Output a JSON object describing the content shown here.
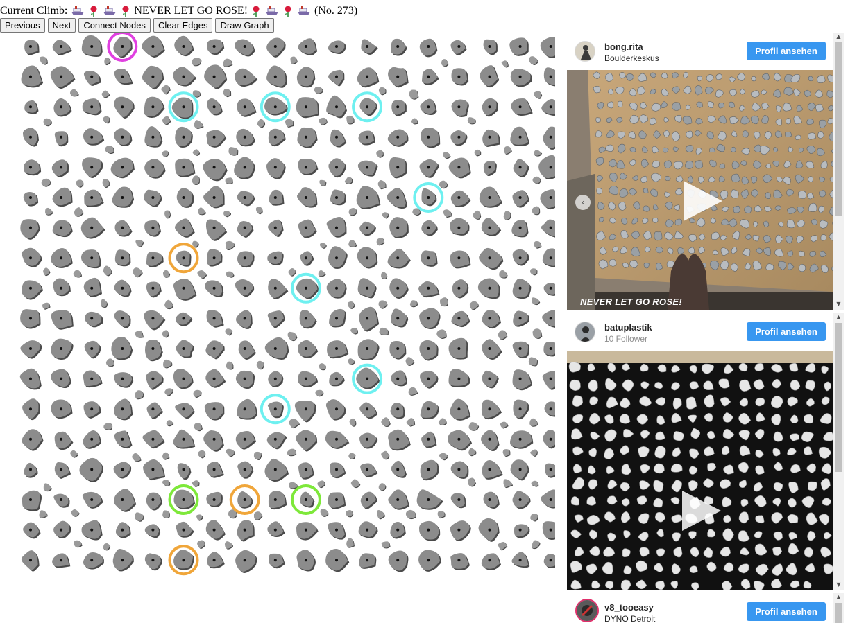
{
  "climb": {
    "label": "Current Climb:",
    "name": "NEVER LET GO ROSE!",
    "number": "(No. 273)"
  },
  "toolbar": {
    "previous_label": "Previous",
    "next_label": "Next",
    "connect_label": "Connect Nodes",
    "clear_label": "Clear Edges",
    "draw_label": "Draw Graph"
  },
  "colors": {
    "start": "#e040e0",
    "hand": "#6ef0f0",
    "foot": "#f0a63a",
    "finish": "#7ee83a",
    "hold": "#8c8c8c",
    "hold_shadow": "#4a4a4a",
    "accent": "#3897f0"
  },
  "board": {
    "cols": 18,
    "rows": 18,
    "marked_holds": [
      {
        "col": 3,
        "row": 0,
        "role": "start"
      },
      {
        "col": 5,
        "row": 2,
        "role": "hand"
      },
      {
        "col": 8,
        "row": 2,
        "role": "hand"
      },
      {
        "col": 11,
        "row": 2,
        "role": "hand"
      },
      {
        "col": 13,
        "row": 5,
        "role": "hand"
      },
      {
        "col": 9,
        "row": 8,
        "role": "hand"
      },
      {
        "col": 11,
        "row": 11,
        "role": "hand"
      },
      {
        "col": 8,
        "row": 12,
        "role": "hand"
      },
      {
        "col": 5,
        "row": 7,
        "role": "foot"
      },
      {
        "col": 7,
        "row": 15,
        "role": "foot"
      },
      {
        "col": 5,
        "row": 17,
        "role": "foot"
      },
      {
        "col": 5,
        "row": 15,
        "role": "finish"
      },
      {
        "col": 9,
        "row": 15,
        "role": "finish"
      }
    ]
  },
  "posts": [
    {
      "username": "bong.rita",
      "subtitle": "Boulderkeskus",
      "button": "Profil ansehen",
      "overlay": "NEVER LET GO ROSE!",
      "avatar_icon": "climber-avatar-icon"
    },
    {
      "username": "batuplastik",
      "subtitle": "10 Follower",
      "button": "Profil ansehen",
      "avatar_icon": "user-avatar-icon"
    },
    {
      "username": "v8_tooeasy",
      "subtitle": "DYNO Detroit",
      "button": "Profil ansehen",
      "avatar_icon": "user-avatar-icon"
    }
  ]
}
